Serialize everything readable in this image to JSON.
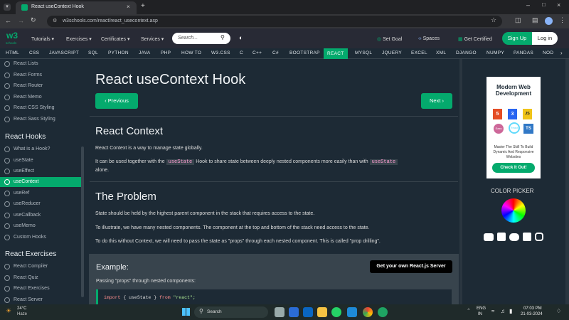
{
  "browser": {
    "tab_title": "React useContext Hook",
    "url": "w3schools.com/react/react_usecontext.asp"
  },
  "topnav": {
    "logo": "w3",
    "logo_sub": "schools",
    "tutorials": "Tutorials",
    "exercises": "Exercises",
    "certificates": "Certificates",
    "services": "Services",
    "search_placeholder": "Search...",
    "set_goal": "Set Goal",
    "spaces": "Spaces",
    "get_certified": "Get Certified",
    "sign_up": "Sign Up",
    "log_in": "Log in"
  },
  "langbar": [
    "HTML",
    "CSS",
    "JAVASCRIPT",
    "SQL",
    "PYTHON",
    "JAVA",
    "PHP",
    "HOW TO",
    "W3.CSS",
    "C",
    "C++",
    "C#",
    "BOOTSTRAP",
    "REACT",
    "MYSQL",
    "JQUERY",
    "EXCEL",
    "XML",
    "DJANGO",
    "NUMPY",
    "PANDAS",
    "NOD"
  ],
  "sidebar": {
    "items_top": [
      "React Lists",
      "React Forms",
      "React Router",
      "React Memo",
      "React CSS Styling",
      "React Sass Styling"
    ],
    "hooks_heading": "React Hooks",
    "hooks": [
      "What is a Hook?",
      "useState",
      "useEffect",
      "useContext",
      "useRef",
      "useReducer",
      "useCallback",
      "useMemo",
      "Custom Hooks"
    ],
    "exercises_heading": "React Exercises",
    "exercises": [
      "React Compiler",
      "React Quiz",
      "React Exercises",
      "React Server"
    ]
  },
  "main": {
    "title": "React useContext Hook",
    "prev": "Previous",
    "next": "Next",
    "h2_context": "React Context",
    "p1": "React Context is a way to manage state globally.",
    "p2_a": "It can be used together with the",
    "p2_code1": "useState",
    "p2_b": "Hook to share state between deeply nested components more easily than with",
    "p2_code2": "useState",
    "p2_c": "alone.",
    "h2_problem": "The Problem",
    "p3": "State should be held by the highest parent component in the stack that requires access to the state.",
    "p4": "To illustrate, we have many nested components. The component at the top and bottom of the stack need access to the state.",
    "p5": "To do this without Context, we will need to pass the state as \"props\" through each nested component. This is called \"prop drilling\".",
    "example_heading": "Example:",
    "server_btn": "Get your own React.js Server",
    "example_desc": "Passing \"props\" through nested components:",
    "code_kw": "import",
    "code_mid": "{ useState }",
    "code_from": "from",
    "code_str": "\"react\";"
  },
  "right": {
    "ad_title": "Modern Web Development",
    "ad_badges": [
      "5",
      "3",
      "JS",
      "Sass",
      "React",
      "TS"
    ],
    "ad_tagline": "Master The Skill To Build Dynamic And Responsive Websites",
    "ad_cta": "Check It Out!",
    "color_picker": "COLOR PICKER"
  },
  "taskbar": {
    "weather_temp": "24°C",
    "weather_desc": "Haze",
    "search": "Search",
    "lang1": "ENG",
    "lang2": "IN",
    "time": "07:03 PM",
    "date": "21-03-2024"
  },
  "colors": {
    "accent": "#04aa6d",
    "bg": "#1d2a35",
    "nav": "#282a35"
  }
}
